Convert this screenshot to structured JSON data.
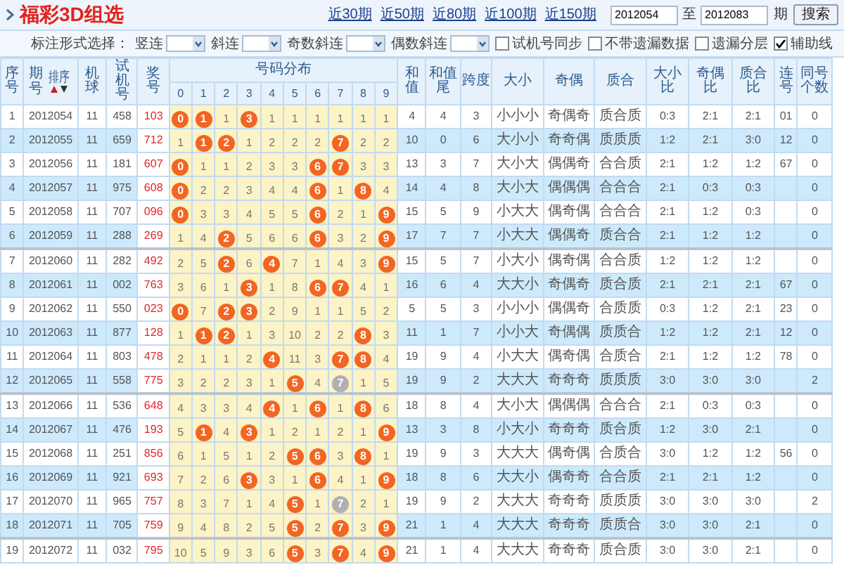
{
  "header": {
    "title": "福彩3D组选",
    "period_links": [
      "近30期",
      "近50期",
      "近80期",
      "近100期",
      "近150期"
    ],
    "range_from": "2012054",
    "range_separator": "至",
    "range_to": "2012083",
    "range_unit": "期",
    "search_button": "搜索"
  },
  "filters": {
    "label": "标注形式选择：",
    "selects": [
      {
        "label": "竖连"
      },
      {
        "label": "斜连"
      },
      {
        "label": "奇数斜连"
      },
      {
        "label": "偶数斜连"
      }
    ],
    "checkboxes": [
      {
        "label": "试机号同步",
        "checked": false
      },
      {
        "label": "不带遗漏数据",
        "checked": false
      },
      {
        "label": "遗漏分层",
        "checked": false
      },
      {
        "label": "辅助线",
        "checked": true
      }
    ]
  },
  "table": {
    "left_columns": [
      "序号",
      "期号",
      "机球",
      "试机号",
      "奖号"
    ],
    "sort_label": "排序",
    "distribution_label": "号码分布",
    "digits": [
      "0",
      "1",
      "2",
      "3",
      "4",
      "5",
      "6",
      "7",
      "8",
      "9"
    ],
    "right_columns": [
      "和值",
      "和值尾",
      "跨度",
      "大小",
      "奇偶",
      "质合",
      "大小比",
      "奇偶比",
      "质合比",
      "连号",
      "同号个数"
    ],
    "rows": [
      {
        "index": "1",
        "issue": "2012054",
        "machine": "11",
        "test_number": "458",
        "winning": "103",
        "distribution": [
          {
            "text": "0",
            "kind": "hit"
          },
          {
            "text": "1",
            "kind": "hit"
          },
          {
            "text": "1",
            "kind": "miss"
          },
          {
            "text": "3",
            "kind": "hit"
          },
          {
            "text": "1",
            "kind": "miss"
          },
          {
            "text": "1",
            "kind": "miss"
          },
          {
            "text": "1",
            "kind": "miss"
          },
          {
            "text": "1",
            "kind": "miss"
          },
          {
            "text": "1",
            "kind": "miss"
          },
          {
            "text": "1",
            "kind": "miss"
          }
        ],
        "stats": [
          "4",
          "4",
          "3",
          "小小小",
          "奇偶奇",
          "质合质",
          "0:3",
          "2:1",
          "2:1"
        ],
        "consecutive": "01",
        "same_count": "0"
      },
      {
        "index": "2",
        "issue": "2012055",
        "machine": "11",
        "test_number": "659",
        "winning": "712",
        "distribution": [
          {
            "text": "1",
            "kind": "miss"
          },
          {
            "text": "1",
            "kind": "hit"
          },
          {
            "text": "2",
            "kind": "hit"
          },
          {
            "text": "1",
            "kind": "miss"
          },
          {
            "text": "2",
            "kind": "miss"
          },
          {
            "text": "2",
            "kind": "miss"
          },
          {
            "text": "2",
            "kind": "miss"
          },
          {
            "text": "7",
            "kind": "hit"
          },
          {
            "text": "2",
            "kind": "miss"
          },
          {
            "text": "2",
            "kind": "miss"
          }
        ],
        "stats": [
          "10",
          "0",
          "6",
          "大小小",
          "奇奇偶",
          "质质质",
          "1:2",
          "2:1",
          "3:0"
        ],
        "consecutive": "12",
        "same_count": "0"
      },
      {
        "index": "3",
        "issue": "2012056",
        "machine": "11",
        "test_number": "181",
        "winning": "607",
        "distribution": [
          {
            "text": "0",
            "kind": "hit"
          },
          {
            "text": "1",
            "kind": "miss"
          },
          {
            "text": "1",
            "kind": "miss"
          },
          {
            "text": "2",
            "kind": "miss"
          },
          {
            "text": "3",
            "kind": "miss"
          },
          {
            "text": "3",
            "kind": "miss"
          },
          {
            "text": "6",
            "kind": "hit"
          },
          {
            "text": "7",
            "kind": "hit"
          },
          {
            "text": "3",
            "kind": "miss"
          },
          {
            "text": "3",
            "kind": "miss"
          }
        ],
        "stats": [
          "13",
          "3",
          "7",
          "大小大",
          "偶偶奇",
          "合合质",
          "2:1",
          "1:2",
          "1:2"
        ],
        "consecutive": "67",
        "same_count": "0"
      },
      {
        "index": "4",
        "issue": "2012057",
        "machine": "11",
        "test_number": "975",
        "winning": "608",
        "distribution": [
          {
            "text": "0",
            "kind": "hit"
          },
          {
            "text": "2",
            "kind": "miss"
          },
          {
            "text": "2",
            "kind": "miss"
          },
          {
            "text": "3",
            "kind": "miss"
          },
          {
            "text": "4",
            "kind": "miss"
          },
          {
            "text": "4",
            "kind": "miss"
          },
          {
            "text": "6",
            "kind": "hit"
          },
          {
            "text": "1",
            "kind": "miss"
          },
          {
            "text": "8",
            "kind": "hit"
          },
          {
            "text": "4",
            "kind": "miss"
          }
        ],
        "stats": [
          "14",
          "4",
          "8",
          "大小大",
          "偶偶偶",
          "合合合",
          "2:1",
          "0:3",
          "0:3"
        ],
        "same_count": "0"
      },
      {
        "index": "5",
        "issue": "2012058",
        "machine": "11",
        "test_number": "707",
        "winning": "096",
        "distribution": [
          {
            "text": "0",
            "kind": "hit"
          },
          {
            "text": "3",
            "kind": "miss"
          },
          {
            "text": "3",
            "kind": "miss"
          },
          {
            "text": "4",
            "kind": "miss"
          },
          {
            "text": "5",
            "kind": "miss"
          },
          {
            "text": "5",
            "kind": "miss"
          },
          {
            "text": "6",
            "kind": "hit"
          },
          {
            "text": "2",
            "kind": "miss"
          },
          {
            "text": "1",
            "kind": "miss"
          },
          {
            "text": "9",
            "kind": "hit"
          }
        ],
        "stats": [
          "15",
          "5",
          "9",
          "小大大",
          "偶奇偶",
          "合合合",
          "2:1",
          "1:2",
          "0:3"
        ],
        "same_count": "0"
      },
      {
        "index": "6",
        "issue": "2012059",
        "machine": "11",
        "test_number": "288",
        "winning": "269",
        "distribution": [
          {
            "text": "1",
            "kind": "miss"
          },
          {
            "text": "4",
            "kind": "miss"
          },
          {
            "text": "2",
            "kind": "hit"
          },
          {
            "text": "5",
            "kind": "miss"
          },
          {
            "text": "6",
            "kind": "miss"
          },
          {
            "text": "6",
            "kind": "miss"
          },
          {
            "text": "6",
            "kind": "hit"
          },
          {
            "text": "3",
            "kind": "miss"
          },
          {
            "text": "2",
            "kind": "miss"
          },
          {
            "text": "9",
            "kind": "hit"
          }
        ],
        "stats": [
          "17",
          "7",
          "7",
          "小大大",
          "偶偶奇",
          "质合合",
          "2:1",
          "1:2",
          "1:2"
        ],
        "same_count": "0"
      },
      {
        "index": "7",
        "issue": "2012060",
        "machine": "11",
        "test_number": "282",
        "winning": "492",
        "distribution": [
          {
            "text": "2",
            "kind": "miss"
          },
          {
            "text": "5",
            "kind": "miss"
          },
          {
            "text": "2",
            "kind": "hit"
          },
          {
            "text": "6",
            "kind": "miss"
          },
          {
            "text": "4",
            "kind": "hit"
          },
          {
            "text": "7",
            "kind": "miss"
          },
          {
            "text": "1",
            "kind": "miss"
          },
          {
            "text": "4",
            "kind": "miss"
          },
          {
            "text": "3",
            "kind": "miss"
          },
          {
            "text": "9",
            "kind": "hit"
          }
        ],
        "stats": [
          "15",
          "5",
          "7",
          "小大小",
          "偶奇偶",
          "合合质",
          "1:2",
          "1:2",
          "1:2"
        ],
        "same_count": "0"
      },
      {
        "index": "8",
        "issue": "2012061",
        "machine": "11",
        "test_number": "002",
        "winning": "763",
        "distribution": [
          {
            "text": "3",
            "kind": "miss"
          },
          {
            "text": "6",
            "kind": "miss"
          },
          {
            "text": "1",
            "kind": "miss"
          },
          {
            "text": "3",
            "kind": "hit"
          },
          {
            "text": "1",
            "kind": "miss"
          },
          {
            "text": "8",
            "kind": "miss"
          },
          {
            "text": "6",
            "kind": "hit"
          },
          {
            "text": "7",
            "kind": "hit"
          },
          {
            "text": "4",
            "kind": "miss"
          },
          {
            "text": "1",
            "kind": "miss"
          }
        ],
        "stats": [
          "16",
          "6",
          "4",
          "大大小",
          "奇偶奇",
          "质合质",
          "2:1",
          "2:1",
          "2:1"
        ],
        "consecutive": "67",
        "same_count": "0"
      },
      {
        "index": "9",
        "issue": "2012062",
        "machine": "11",
        "test_number": "550",
        "winning": "023",
        "distribution": [
          {
            "text": "0",
            "kind": "hit"
          },
          {
            "text": "7",
            "kind": "miss"
          },
          {
            "text": "2",
            "kind": "hit"
          },
          {
            "text": "3",
            "kind": "hit"
          },
          {
            "text": "2",
            "kind": "miss"
          },
          {
            "text": "9",
            "kind": "miss"
          },
          {
            "text": "1",
            "kind": "miss"
          },
          {
            "text": "1",
            "kind": "miss"
          },
          {
            "text": "5",
            "kind": "miss"
          },
          {
            "text": "2",
            "kind": "miss"
          }
        ],
        "stats": [
          "5",
          "5",
          "3",
          "小小小",
          "偶偶奇",
          "合质质",
          "0:3",
          "1:2",
          "2:1"
        ],
        "consecutive": "23",
        "same_count": "0"
      },
      {
        "index": "10",
        "issue": "2012063",
        "machine": "11",
        "test_number": "877",
        "winning": "128",
        "distribution": [
          {
            "text": "1",
            "kind": "miss"
          },
          {
            "text": "1",
            "kind": "hit"
          },
          {
            "text": "2",
            "kind": "hit"
          },
          {
            "text": "1",
            "kind": "miss"
          },
          {
            "text": "3",
            "kind": "miss"
          },
          {
            "text": "10",
            "kind": "miss"
          },
          {
            "text": "2",
            "kind": "miss"
          },
          {
            "text": "2",
            "kind": "miss"
          },
          {
            "text": "8",
            "kind": "hit"
          },
          {
            "text": "3",
            "kind": "miss"
          }
        ],
        "stats": [
          "11",
          "1",
          "7",
          "小小大",
          "奇偶偶",
          "质质合",
          "1:2",
          "1:2",
          "2:1"
        ],
        "consecutive": "12",
        "same_count": "0"
      },
      {
        "index": "11",
        "issue": "2012064",
        "machine": "11",
        "test_number": "803",
        "winning": "478",
        "distribution": [
          {
            "text": "2",
            "kind": "miss"
          },
          {
            "text": "1",
            "kind": "miss"
          },
          {
            "text": "1",
            "kind": "miss"
          },
          {
            "text": "2",
            "kind": "miss"
          },
          {
            "text": "4",
            "kind": "hit"
          },
          {
            "text": "11",
            "kind": "miss"
          },
          {
            "text": "3",
            "kind": "miss"
          },
          {
            "text": "7",
            "kind": "hit"
          },
          {
            "text": "8",
            "kind": "hit"
          },
          {
            "text": "4",
            "kind": "miss"
          }
        ],
        "stats": [
          "19",
          "9",
          "4",
          "小大大",
          "偶奇偶",
          "合质合",
          "2:1",
          "1:2",
          "1:2"
        ],
        "consecutive": "78",
        "same_count": "0"
      },
      {
        "index": "12",
        "issue": "2012065",
        "machine": "11",
        "test_number": "558",
        "winning": "775",
        "distribution": [
          {
            "text": "3",
            "kind": "miss"
          },
          {
            "text": "2",
            "kind": "miss"
          },
          {
            "text": "2",
            "kind": "miss"
          },
          {
            "text": "3",
            "kind": "miss"
          },
          {
            "text": "1",
            "kind": "miss"
          },
          {
            "text": "5",
            "kind": "hit"
          },
          {
            "text": "4",
            "kind": "miss"
          },
          {
            "text": "7",
            "kind": "repeat"
          },
          {
            "text": "1",
            "kind": "miss"
          },
          {
            "text": "5",
            "kind": "miss"
          }
        ],
        "stats": [
          "19",
          "9",
          "2",
          "大大大",
          "奇奇奇",
          "质质质",
          "3:0",
          "3:0",
          "3:0"
        ],
        "same_count": "2"
      },
      {
        "index": "13",
        "issue": "2012066",
        "machine": "11",
        "test_number": "536",
        "winning": "648",
        "distribution": [
          {
            "text": "4",
            "kind": "miss"
          },
          {
            "text": "3",
            "kind": "miss"
          },
          {
            "text": "3",
            "kind": "miss"
          },
          {
            "text": "4",
            "kind": "miss"
          },
          {
            "text": "4",
            "kind": "hit"
          },
          {
            "text": "1",
            "kind": "miss"
          },
          {
            "text": "6",
            "kind": "hit"
          },
          {
            "text": "1",
            "kind": "miss"
          },
          {
            "text": "8",
            "kind": "hit"
          },
          {
            "text": "6",
            "kind": "miss"
          }
        ],
        "stats": [
          "18",
          "8",
          "4",
          "大小大",
          "偶偶偶",
          "合合合",
          "2:1",
          "0:3",
          "0:3"
        ],
        "same_count": "0"
      },
      {
        "index": "14",
        "issue": "2012067",
        "machine": "11",
        "test_number": "476",
        "winning": "193",
        "distribution": [
          {
            "text": "5",
            "kind": "miss"
          },
          {
            "text": "1",
            "kind": "hit"
          },
          {
            "text": "4",
            "kind": "miss"
          },
          {
            "text": "3",
            "kind": "hit"
          },
          {
            "text": "1",
            "kind": "miss"
          },
          {
            "text": "2",
            "kind": "miss"
          },
          {
            "text": "1",
            "kind": "miss"
          },
          {
            "text": "2",
            "kind": "miss"
          },
          {
            "text": "1",
            "kind": "miss"
          },
          {
            "text": "9",
            "kind": "hit"
          }
        ],
        "stats": [
          "13",
          "3",
          "8",
          "小大小",
          "奇奇奇",
          "质合质",
          "1:2",
          "3:0",
          "2:1"
        ],
        "same_count": "0"
      },
      {
        "index": "15",
        "issue": "2012068",
        "machine": "11",
        "test_number": "251",
        "winning": "856",
        "distribution": [
          {
            "text": "6",
            "kind": "miss"
          },
          {
            "text": "1",
            "kind": "miss"
          },
          {
            "text": "5",
            "kind": "miss"
          },
          {
            "text": "1",
            "kind": "miss"
          },
          {
            "text": "2",
            "kind": "miss"
          },
          {
            "text": "5",
            "kind": "hit"
          },
          {
            "text": "6",
            "kind": "hit"
          },
          {
            "text": "3",
            "kind": "miss"
          },
          {
            "text": "8",
            "kind": "hit"
          },
          {
            "text": "1",
            "kind": "miss"
          }
        ],
        "stats": [
          "19",
          "9",
          "3",
          "大大大",
          "偶奇偶",
          "合质合",
          "3:0",
          "1:2",
          "1:2"
        ],
        "consecutive": "56",
        "same_count": "0"
      },
      {
        "index": "16",
        "issue": "2012069",
        "machine": "11",
        "test_number": "921",
        "winning": "693",
        "distribution": [
          {
            "text": "7",
            "kind": "miss"
          },
          {
            "text": "2",
            "kind": "miss"
          },
          {
            "text": "6",
            "kind": "miss"
          },
          {
            "text": "3",
            "kind": "hit"
          },
          {
            "text": "3",
            "kind": "miss"
          },
          {
            "text": "1",
            "kind": "miss"
          },
          {
            "text": "6",
            "kind": "hit"
          },
          {
            "text": "4",
            "kind": "miss"
          },
          {
            "text": "1",
            "kind": "miss"
          },
          {
            "text": "9",
            "kind": "hit"
          }
        ],
        "stats": [
          "18",
          "8",
          "6",
          "大大小",
          "偶奇奇",
          "合合质",
          "2:1",
          "2:1",
          "1:2"
        ],
        "same_count": "0"
      },
      {
        "index": "17",
        "issue": "2012070",
        "machine": "11",
        "test_number": "965",
        "winning": "757",
        "distribution": [
          {
            "text": "8",
            "kind": "miss"
          },
          {
            "text": "3",
            "kind": "miss"
          },
          {
            "text": "7",
            "kind": "miss"
          },
          {
            "text": "1",
            "kind": "miss"
          },
          {
            "text": "4",
            "kind": "miss"
          },
          {
            "text": "5",
            "kind": "hit"
          },
          {
            "text": "1",
            "kind": "miss"
          },
          {
            "text": "7",
            "kind": "repeat"
          },
          {
            "text": "2",
            "kind": "miss"
          },
          {
            "text": "1",
            "kind": "miss"
          }
        ],
        "stats": [
          "19",
          "9",
          "2",
          "大大大",
          "奇奇奇",
          "质质质",
          "3:0",
          "3:0",
          "3:0"
        ],
        "same_count": "2"
      },
      {
        "index": "18",
        "issue": "2012071",
        "machine": "11",
        "test_number": "705",
        "winning": "759",
        "distribution": [
          {
            "text": "9",
            "kind": "miss"
          },
          {
            "text": "4",
            "kind": "miss"
          },
          {
            "text": "8",
            "kind": "miss"
          },
          {
            "text": "2",
            "kind": "miss"
          },
          {
            "text": "5",
            "kind": "miss"
          },
          {
            "text": "5",
            "kind": "hit"
          },
          {
            "text": "2",
            "kind": "miss"
          },
          {
            "text": "7",
            "kind": "hit"
          },
          {
            "text": "3",
            "kind": "miss"
          },
          {
            "text": "9",
            "kind": "hit"
          }
        ],
        "stats": [
          "21",
          "1",
          "4",
          "大大大",
          "奇奇奇",
          "质质合",
          "3:0",
          "3:0",
          "2:1"
        ],
        "same_count": "0"
      },
      {
        "index": "19",
        "issue": "2012072",
        "machine": "11",
        "test_number": "032",
        "winning": "795",
        "distribution": [
          {
            "text": "10",
            "kind": "miss"
          },
          {
            "text": "5",
            "kind": "miss"
          },
          {
            "text": "9",
            "kind": "miss"
          },
          {
            "text": "3",
            "kind": "miss"
          },
          {
            "text": "6",
            "kind": "miss"
          },
          {
            "text": "5",
            "kind": "hit"
          },
          {
            "text": "3",
            "kind": "miss"
          },
          {
            "text": "7",
            "kind": "hit"
          },
          {
            "text": "4",
            "kind": "miss"
          },
          {
            "text": "9",
            "kind": "hit"
          }
        ],
        "stats": [
          "21",
          "1",
          "4",
          "大大大",
          "奇奇奇",
          "质合质",
          "3:0",
          "3:0",
          "2:1"
        ],
        "same_count": "0"
      }
    ]
  }
}
